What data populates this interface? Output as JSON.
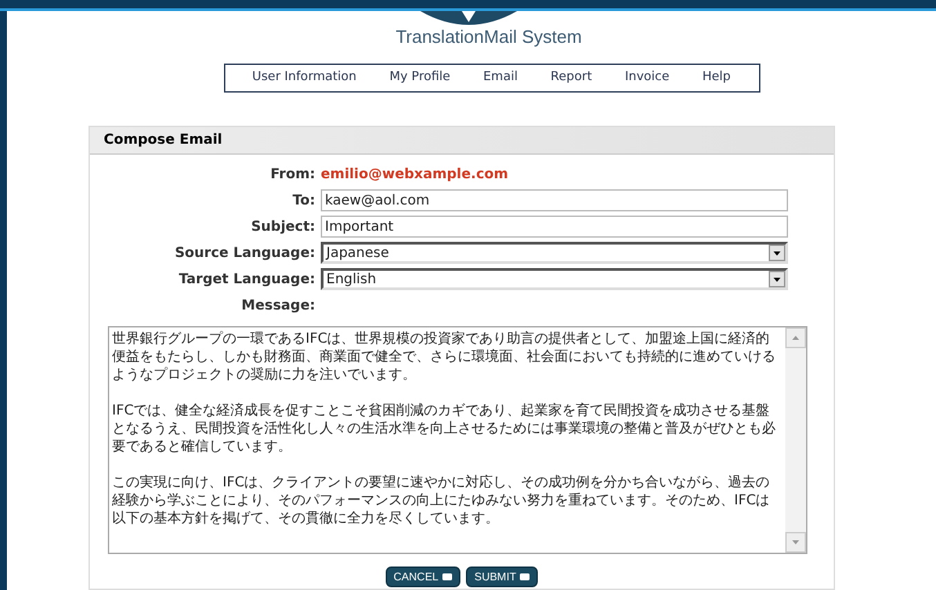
{
  "app_title": "TranslationMail System",
  "nav": [
    {
      "label": "User Information"
    },
    {
      "label": "My Profile"
    },
    {
      "label": "Email"
    },
    {
      "label": "Report"
    },
    {
      "label": "Invoice"
    },
    {
      "label": "Help"
    }
  ],
  "panel_title": "Compose Email",
  "from": {
    "label": "From:",
    "value": "emilio@webxample.com"
  },
  "fields": [
    {
      "kind": "text",
      "label": "To:",
      "value": "kaew@aol.com"
    },
    {
      "kind": "text",
      "label": "Subject:",
      "value": "Important"
    },
    {
      "kind": "select",
      "label": "Source Language:",
      "value": "Japanese"
    },
    {
      "kind": "select",
      "label": "Target Language:",
      "value": "English"
    }
  ],
  "message": {
    "label": "Message:",
    "paragraphs": [
      "世界銀行グループの一環であるIFCは、世界規模の投資家であり助言の提供者として、加盟途上国に経済的便益をもたらし、しかも財務面、商業面で健全で、さらに環境面、社会面においても持続的に進めていけるようなプロジェクトの奨励に力を注いでいます。",
      "IFCでは、健全な経済成長を促すことこそ貧困削減のカギであり、起業家を育て民間投資を成功させる基盤となるうえ、民間投資を活性化し人々の生活水準を向上させるためには事業環境の整備と普及がぜひとも必要であると確信しています。",
      "この実現に向け、IFCは、クライアントの要望に速やかに対応し、その成功例を分かち合いながら、過去の経験から学ぶことにより、そのパフォーマンスの向上にたゆみない努力を重ねています。そのため、IFCは以下の基本方針を掲げて、その貫徹に全力を尽くしています。"
    ]
  },
  "buttons": [
    {
      "label": "CANCEL"
    },
    {
      "label": "SUBMIT"
    }
  ]
}
